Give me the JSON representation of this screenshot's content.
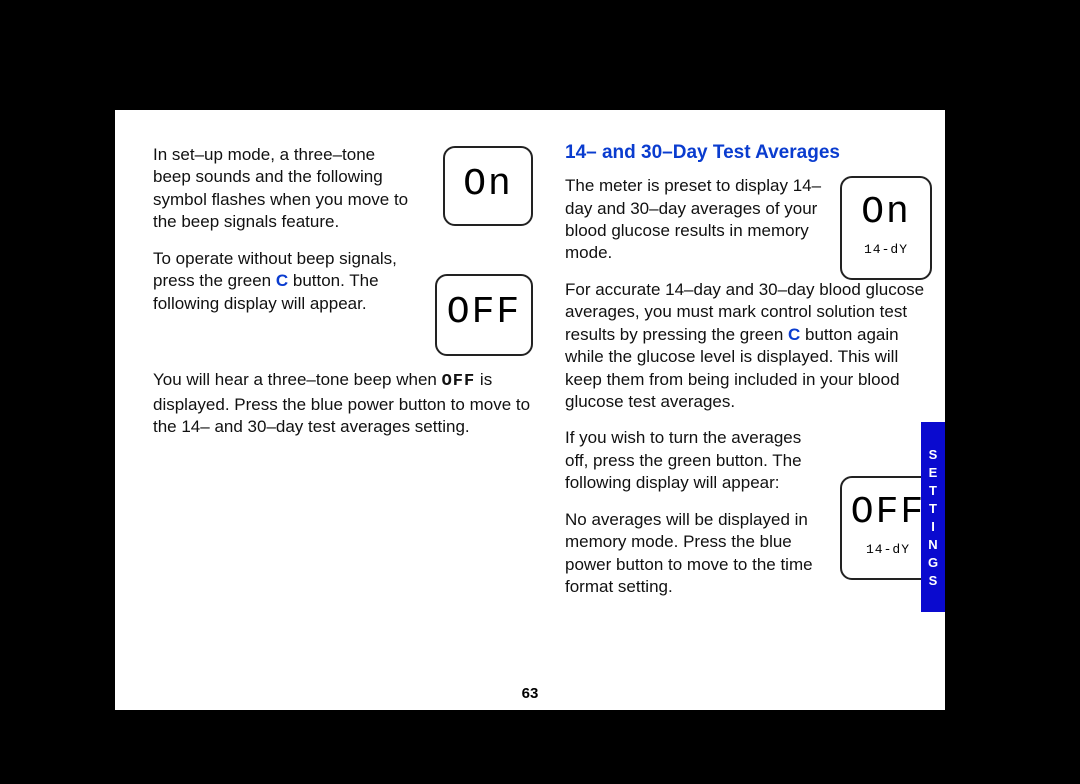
{
  "left": {
    "p1": "In set–up mode, a three–tone beep sounds and the following symbol flashes when you move to the beep signals feature.",
    "p2a": "To operate without beep signals, press the green ",
    "p2_c": "C",
    "p2b": " button. The following display will appear.",
    "p3a": "You will hear a three–tone beep when ",
    "p3_off": "OFF",
    "p3b": " is displayed. Press the blue power button to move to the 14– and 30–day test averages setting."
  },
  "right": {
    "title": "14– and 30–Day Test Averages",
    "p1": "The meter is preset to display 14–day and 30–day averages of your blood glucose results in memory mode.",
    "p2a": "For accurate 14–day and 30–day blood glucose averages, you must mark control solution test results by pressing the green ",
    "p2_c": "C",
    "p2b": " button again while the glucose level is displayed. This will keep them from being included in your blood glucose test averages.",
    "p3": "If you wish to turn the averages off, press the green button. The following display will appear:",
    "p4": "No averages will be displayed in memory mode. Press the blue power button to move to the time format setting."
  },
  "lcd": {
    "on_left": "On",
    "off_left": "OFF",
    "on_right": "On",
    "on_right_sub": "14-dY",
    "off_right": "OFF",
    "off_right_sub": "14-dY"
  },
  "page_number": "63",
  "side_tab": "SETTINGS"
}
